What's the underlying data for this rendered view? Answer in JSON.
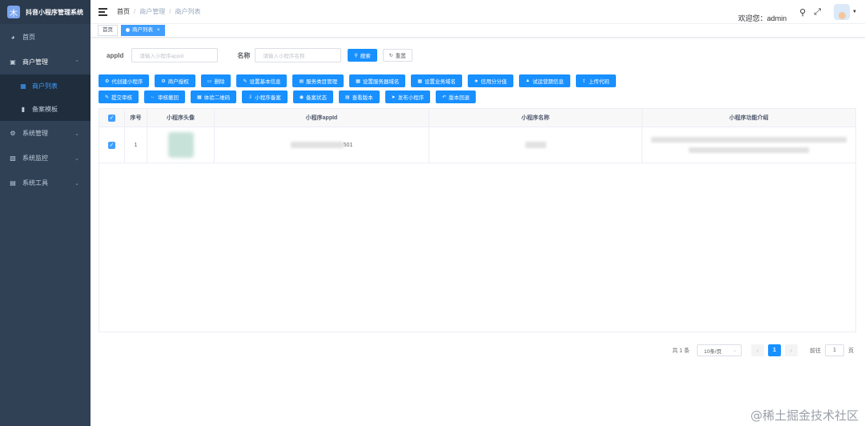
{
  "app": {
    "title": "抖音小程序管理系统",
    "logo_char": "木"
  },
  "sidebar": {
    "items": [
      {
        "label": "首页",
        "icon": "dashboard-icon"
      },
      {
        "label": "商户管理",
        "icon": "shop-icon",
        "children": [
          {
            "label": "商户列表",
            "icon": "list-icon"
          },
          {
            "label": "备案模板",
            "icon": "template-icon"
          }
        ]
      },
      {
        "label": "系统管理",
        "icon": "gear-icon"
      },
      {
        "label": "系统监控",
        "icon": "monitor-icon"
      },
      {
        "label": "系统工具",
        "icon": "tool-icon"
      }
    ]
  },
  "breadcrumb": [
    "首页",
    "商户管理",
    "商户列表"
  ],
  "header": {
    "welcome": "欢迎您：admin"
  },
  "tags": [
    {
      "label": "首页"
    },
    {
      "label": "商户列表",
      "close": "×"
    }
  ],
  "search": {
    "appid_label": "appId",
    "appid_placeholder": "请输入小程序appid",
    "name_label": "名称",
    "name_placeholder": "请输入小程序名称",
    "search_btn": "搜索",
    "reset_btn": "重置"
  },
  "toolbar_row1": [
    {
      "label": "代创建小程序",
      "icon": "gear-icon"
    },
    {
      "label": "商户授权",
      "icon": "gear-icon"
    },
    {
      "label": "删除",
      "icon": "trash-icon"
    },
    {
      "label": "设置基本信息",
      "icon": "edit-icon"
    },
    {
      "label": "服务类目管理",
      "icon": "doc-icon"
    },
    {
      "label": "设置服务器域名",
      "icon": "grid-icon"
    },
    {
      "label": "设置业务域名",
      "icon": "grid-icon"
    },
    {
      "label": "信用分分值",
      "icon": "star-icon"
    },
    {
      "label": "试运营期信息",
      "icon": "lock-icon"
    },
    {
      "label": "上传代码",
      "icon": "upload-icon"
    }
  ],
  "toolbar_row2": [
    {
      "label": "提交审核",
      "icon": "edit-icon"
    },
    {
      "label": "审核撤回",
      "icon": "back-icon"
    },
    {
      "label": "体验二维码",
      "icon": "qr-icon"
    },
    {
      "label": "小程序备案",
      "icon": "download-icon"
    },
    {
      "label": "备案状态",
      "icon": "info-icon"
    },
    {
      "label": "查看版本",
      "icon": "doc-icon"
    },
    {
      "label": "发布小程序",
      "icon": "send-icon"
    },
    {
      "label": "版本回退",
      "icon": "rollback-icon"
    }
  ],
  "table": {
    "columns": [
      "序号",
      "小程序头像",
      "小程序appId",
      "小程序名称",
      "小程序功能介绍"
    ],
    "rows": [
      {
        "index": "1",
        "appid_suffix": "501"
      }
    ]
  },
  "pagination": {
    "total": "共 1 条",
    "page_size": "10条/页",
    "current": "1",
    "goto_label": "前往",
    "goto_value": "1",
    "page_unit": "页"
  },
  "watermark": "@稀土掘金技术社区",
  "colors": {
    "primary": "#1890ff",
    "sidebar": "#304156",
    "active_menu": "#409eff"
  }
}
